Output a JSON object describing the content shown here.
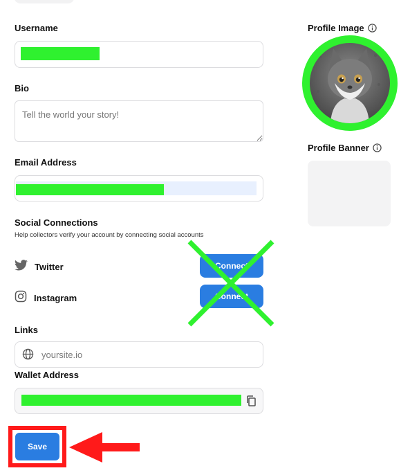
{
  "form": {
    "username_label": "Username",
    "bio_label": "Bio",
    "bio_placeholder": "Tell the world your story!",
    "email_label": "Email Address",
    "social_label": "Social Connections",
    "social_help": "Help collectors verify your account by connecting social accounts",
    "twitter_label": "Twitter",
    "instagram_label": "Instagram",
    "connect_label": "Connect",
    "links_label": "Links",
    "links_placeholder": "yoursite.io",
    "wallet_label": "Wallet Address",
    "save_label": "Save"
  },
  "side": {
    "profile_image_label": "Profile Image",
    "profile_banner_label": "Profile Banner"
  },
  "icons": {
    "twitter": "twitter-icon",
    "instagram": "instagram-icon",
    "globe": "globe-icon",
    "copy": "copy-icon",
    "info": "info-icon"
  },
  "colors": {
    "accent": "#2a7de1",
    "redaction": "#2ff12f",
    "annotation": "#ff1a1a"
  }
}
